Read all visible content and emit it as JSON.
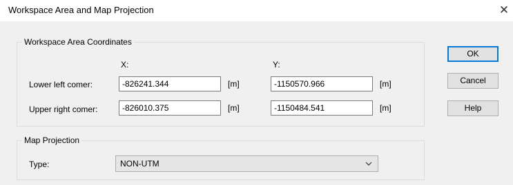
{
  "dialog": {
    "title": "Workspace Area and Map Projection",
    "close_glyph": "✕"
  },
  "workspace": {
    "group_label": "Workspace Area Coordinates",
    "x_header": "X:",
    "y_header": "Y:",
    "rows": [
      {
        "label": "Lower left comer:",
        "x": "-826241.344",
        "x_unit": "[m]",
        "y": "-1150570.966",
        "y_unit": "[m]"
      },
      {
        "label": "Upper right comer:",
        "x": "-826010.375",
        "x_unit": "[m]",
        "y": "-1150484.541",
        "y_unit": "[m]"
      }
    ]
  },
  "projection": {
    "group_label": "Map Projection",
    "type_label": "Type:",
    "type_value": "NON-UTM"
  },
  "buttons": {
    "ok": "OK",
    "cancel": "Cancel",
    "help": "Help"
  },
  "colors": {
    "dialog_bg": "#f0f0f0",
    "default_button_border": "#0078d7",
    "button_bg": "#e1e1e1"
  }
}
